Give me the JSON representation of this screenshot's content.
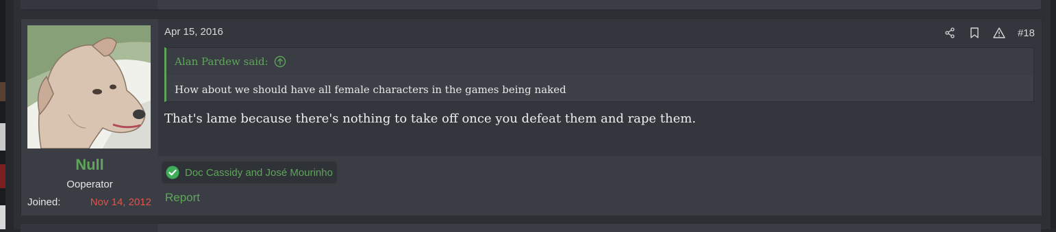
{
  "post": {
    "date": "Apr 15, 2016",
    "number": "#18",
    "actions": [
      {
        "icon": "share-icon"
      },
      {
        "icon": "bookmark-icon"
      },
      {
        "icon": "report-warning-icon"
      }
    ],
    "quote": {
      "author": "Alan Pardew said:",
      "jump_icon": "arrow-up-circle-icon",
      "text": "How about we should have all female characters in the games being naked"
    },
    "text": "That's lame because there's nothing to take off once you defeat them and rape them.",
    "reactions": {
      "icon": "check-circle-icon",
      "names": "Doc Cassidy and José Mourinho"
    },
    "report_label": "Report"
  },
  "author": {
    "name": "Null",
    "title": "Ooperator",
    "joined_label": "Joined:",
    "joined_date": "Nov 14, 2012"
  },
  "colors": {
    "accent": "#5fa55a",
    "joined": "#e0534a",
    "panel": "#3a3d44",
    "main_bg": "#33363c"
  }
}
